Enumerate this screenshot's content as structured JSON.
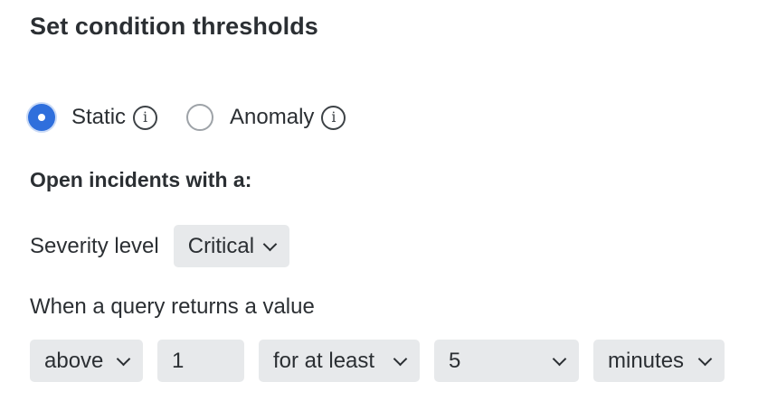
{
  "title": "Set condition thresholds",
  "threshold_type": {
    "options": [
      {
        "label": "Static",
        "checked": true,
        "info_icon": "info-icon"
      },
      {
        "label": "Anomaly",
        "checked": false,
        "info_icon": "info-icon"
      }
    ],
    "info_glyph": "i"
  },
  "open_incidents_label": "Open incidents with a:",
  "severity": {
    "label": "Severity level",
    "value": "Critical"
  },
  "query": {
    "label": "When a query returns a value",
    "operator": "above",
    "threshold_value": "1",
    "duration_mode": "for at least",
    "duration_value": "5",
    "duration_unit": "minutes"
  },
  "colors": {
    "accent": "#2f6fdc",
    "select_bg": "#e7e9eb",
    "text": "#2b2f33"
  }
}
